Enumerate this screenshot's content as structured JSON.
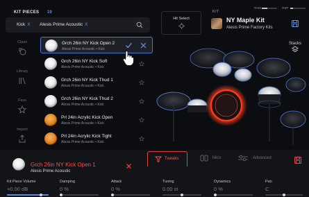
{
  "library": {
    "title": "KIT PIECES",
    "count": "19",
    "filters": [
      {
        "label": "Kick",
        "remove": "X"
      },
      {
        "label": "Alesis Prime Acoustic",
        "remove": "X"
      }
    ]
  },
  "rail": [
    {
      "label": "Class",
      "icon": "class-icon"
    },
    {
      "label": "Library",
      "icon": "library-icon"
    },
    {
      "label": "Favs",
      "icon": "star-icon"
    },
    {
      "label": "Import",
      "icon": "import-icon"
    }
  ],
  "pieces": [
    {
      "name": "Grch 26in NY Kick Open 2",
      "sub": "Alesis Prime Acoustic • Kick",
      "thumb": "white",
      "selected": true
    },
    {
      "name": "Grch 26in NY Kick Soft",
      "sub": "Alesis Prime Acoustic • Kick",
      "thumb": "white",
      "selected": false
    },
    {
      "name": "Grch 26in NY Kick Thud 1",
      "sub": "Alesis Prime Acoustic • Kick",
      "thumb": "white",
      "selected": false
    },
    {
      "name": "Grch 26in NY Kick Thud 2",
      "sub": "Alesis Prime Acoustic • Kick",
      "thumb": "white",
      "selected": false
    },
    {
      "name": "Prl 24in Acrylic Kick Open",
      "sub": "Alesis Prime Acoustic • Kick",
      "thumb": "orange",
      "selected": false
    },
    {
      "name": "Prl 24in Acrylic Kick Tight",
      "sub": "Alesis Prime Acoustic • Kick",
      "thumb": "orange",
      "selected": false
    }
  ],
  "hit_select": {
    "label": "Hit Select"
  },
  "kit": {
    "label": "KIT",
    "name": "NY Maple Kit",
    "sub": "Alesis Prime Factory Kits",
    "ram_label": "RAM",
    "dsp_label": "DSP"
  },
  "stacks": {
    "label": "Stacks"
  },
  "selected_piece": {
    "name": "Grch 26in NY Kick Open 1",
    "sub": "Alesis Prime Acoustic",
    "close": "×"
  },
  "tabs": [
    {
      "label": "Tweaks",
      "active": true
    },
    {
      "label": "Mics",
      "active": false
    },
    {
      "label": "Advanced",
      "active": false
    }
  ],
  "params": [
    {
      "label": "Kit Piece Volume",
      "value": "+0.00 dB",
      "level": 0.82
    },
    {
      "label": "Damping",
      "value": "0 %",
      "level": 0.0
    },
    {
      "label": "Attack",
      "value": "0 %",
      "level": 0.0
    },
    {
      "label": "Tuning",
      "value": "0.00 st",
      "level": 0.5
    },
    {
      "label": "Dynamics",
      "value": "0 %",
      "level": 0.0
    },
    {
      "label": "Pan",
      "value": "C",
      "level": 0.5
    }
  ],
  "colors": {
    "accent_blue": "#4f79d0",
    "accent_red": "#ff4c4c",
    "background": "#0c0d10"
  }
}
